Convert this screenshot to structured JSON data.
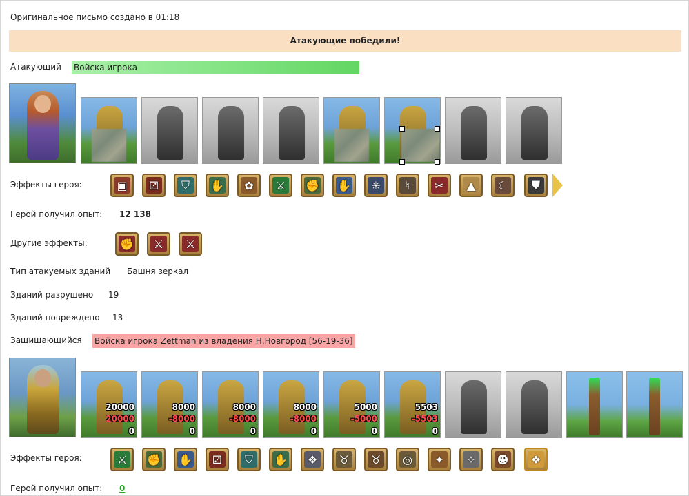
{
  "created_line": "Оригинальное письмо создано в 01:18",
  "result_banner": "Атакующие победили!",
  "attacker": {
    "label": "Атакующий",
    "name": "Войска игрока",
    "effects_label": "Эффекты героя:",
    "effects_icons": [
      "tower-shield-icon",
      "dice-fist-icon",
      "shield-icon",
      "hand-shield-icon",
      "paw-icon",
      "sword-icon",
      "hand-sword-icon",
      "hand-icon",
      "spider-web-icon",
      "bell-icon",
      "broken-chain-icon",
      "tent-icon",
      "scythe-icon",
      "heraldic-shield-icon"
    ],
    "exp_label": "Герой получил опыт:",
    "exp_value": "12 138",
    "other_label": "Другие эффекты:",
    "other_icons": [
      "fist-icon",
      "hand-sword-icon",
      "fist-sword-icon"
    ]
  },
  "buildings": {
    "type_label": "Тип атакуемых зданий",
    "type_value": "Башня зеркал",
    "destroyed_label": "Зданий разрушено",
    "destroyed_value": "19",
    "damaged_label": "Зданий повреждено",
    "damaged_value": "13"
  },
  "defender": {
    "label": "Защищающийся",
    "name": "Войска игрока Zettman из владения Н.Новгород [56-19-36]",
    "units": [
      {
        "count": "20000",
        "loss": "20000",
        "left": "0"
      },
      {
        "count": "8000",
        "loss": "-8000",
        "left": "0"
      },
      {
        "count": "8000",
        "loss": "-8000",
        "left": "0"
      },
      {
        "count": "8000",
        "loss": "-8000",
        "left": "0"
      },
      {
        "count": "5000",
        "loss": "-5000",
        "left": "0"
      },
      {
        "count": "5503",
        "loss": "-5503",
        "left": "0"
      }
    ],
    "effects_label": "Эффекты героя:",
    "effects_icons": [
      "sword-icon",
      "hand-sword-icon",
      "hand-icon",
      "dice-fist-icon",
      "shield-icon",
      "hand-shield-icon",
      "wolf-icon",
      "horns-icon",
      "bull-icon",
      "ring-icon",
      "bat-icon",
      "claw-icon",
      "ogre-icon",
      "wolf-gold-icon"
    ],
    "exp_label": "Герой получил опыт:",
    "exp_value": "0"
  },
  "colors": {
    "banner_bg": "#fbdfc2",
    "attacker_name_bg": "#7fe27f",
    "defender_name_bg": "#f7a5a5",
    "loss_text": "#ff4a4a",
    "exp_zero": "#2aa52a"
  }
}
